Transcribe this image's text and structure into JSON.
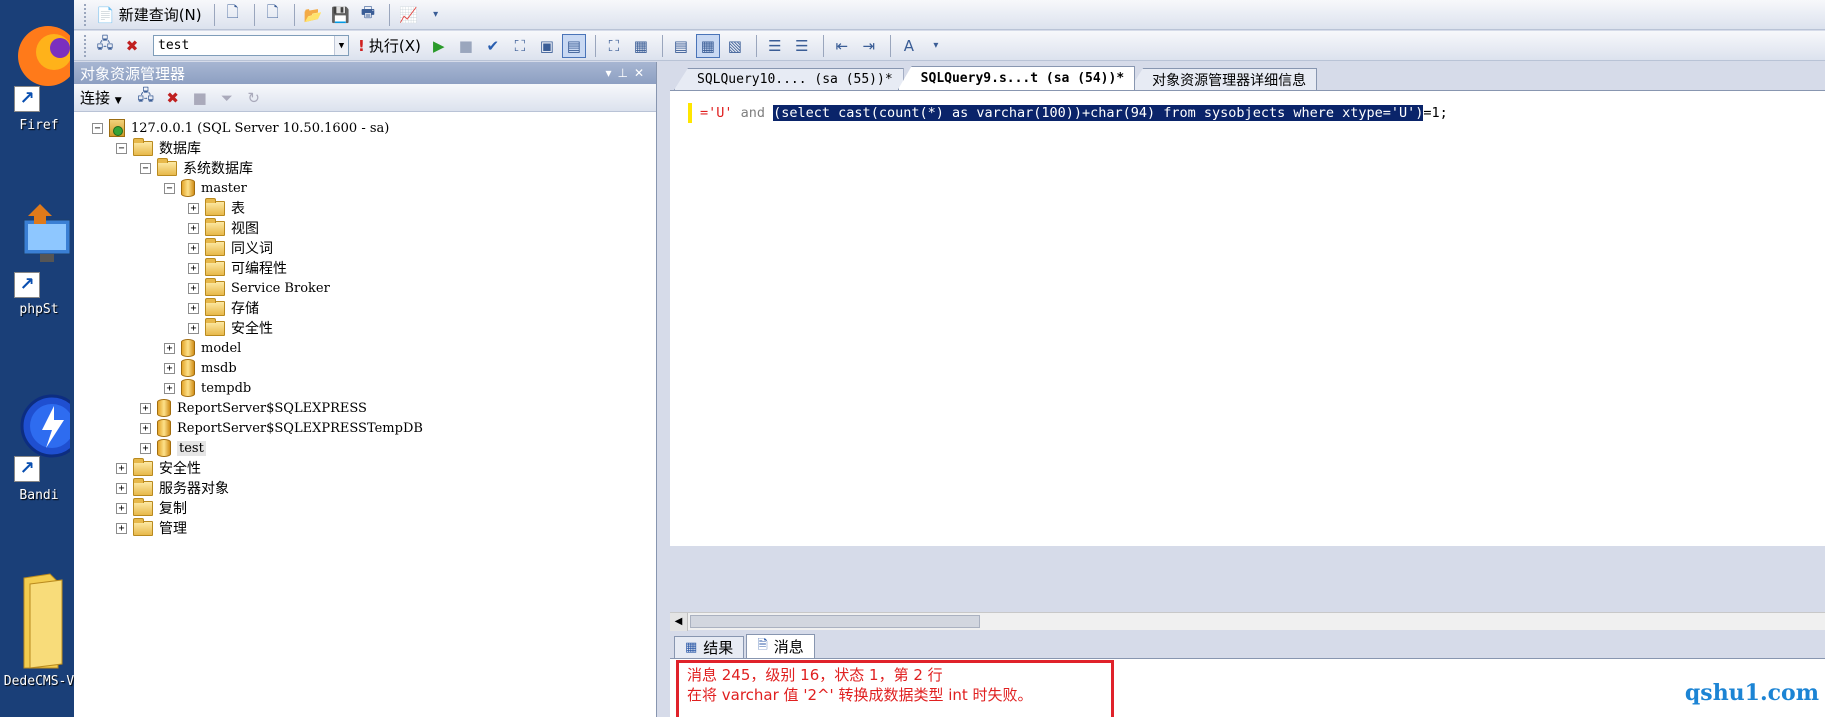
{
  "desktop": {
    "icons": [
      {
        "name": "firefox",
        "label": "Firef"
      },
      {
        "name": "phpstorm",
        "label": "phpSt"
      },
      {
        "name": "bandizip",
        "label": "Bandi"
      },
      {
        "name": "dedecms",
        "label": "DedeCMS-V"
      }
    ]
  },
  "toolbar1": {
    "new_query_label": "新建查询(N)"
  },
  "toolbar2": {
    "database_selected": "test",
    "execute_label": "执行(X)"
  },
  "object_explorer": {
    "title": "对象资源管理器",
    "connect_label": "连接",
    "tree": {
      "server": "127.0.0.1 (SQL Server 10.50.1600 - sa)",
      "databases": "数据库",
      "system_databases": "系统数据库",
      "master": "master",
      "master_children": [
        "表",
        "视图",
        "同义词",
        "可编程性",
        "Service Broker",
        "存储",
        "安全性"
      ],
      "model": "model",
      "msdb": "msdb",
      "tempdb": "tempdb",
      "reportserver": "ReportServer$SQLEXPRESS",
      "reportserver_temp": "ReportServer$SQLEXPRESSTempDB",
      "test": "test",
      "top_level": [
        "安全性",
        "服务器对象",
        "复制",
        "管理"
      ]
    }
  },
  "editor": {
    "tabs": [
      "SQLQuery10.... (sa (55))*",
      "SQLQuery9.s...t (sa (54))*",
      "对象资源管理器详细信息"
    ],
    "code": {
      "part1": "='U'",
      "part2": " and ",
      "part3": "(select cast(count(*) as varchar(100))+char(94) from sysobjects where xtype='U')",
      "part4": "=1;"
    }
  },
  "results": {
    "tab_results": "结果",
    "tab_messages": "消息",
    "message_line1": "消息 245，级别 16，状态 1，第 2 行",
    "message_line2": "在将 varchar 值 '2^' 转换成数据类型 int 时失败。"
  },
  "watermark": "qshu1.com"
}
